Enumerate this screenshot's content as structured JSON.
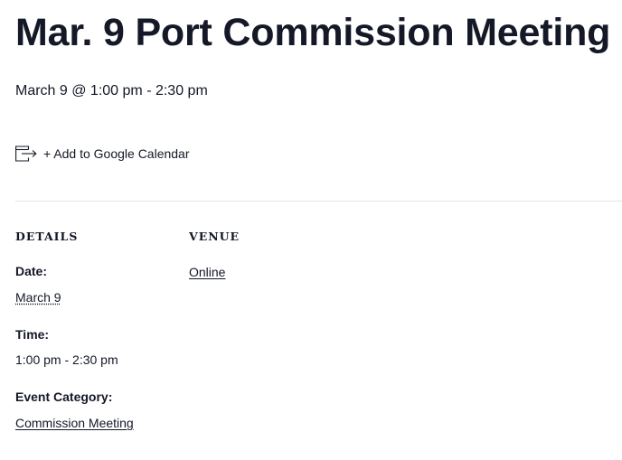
{
  "event": {
    "title": "Mar. 9 Port Commission Meeting",
    "datetime": "March 9 @ 1:00 pm - 2:30 pm"
  },
  "calendar": {
    "icon": "calendar-export-icon",
    "add_label": "+ Add to Google Calendar"
  },
  "details": {
    "heading": "DETAILS",
    "date_label": "Date:",
    "date_value": "March 9",
    "time_label": "Time:",
    "time_value": "1:00 pm - 2:30 pm",
    "category_label": "Event Category:",
    "category_value": "Commission Meeting"
  },
  "venue": {
    "heading": "VENUE",
    "name": "Online"
  },
  "colors": {
    "text": "#141827",
    "divider": "#e4e4e4"
  }
}
